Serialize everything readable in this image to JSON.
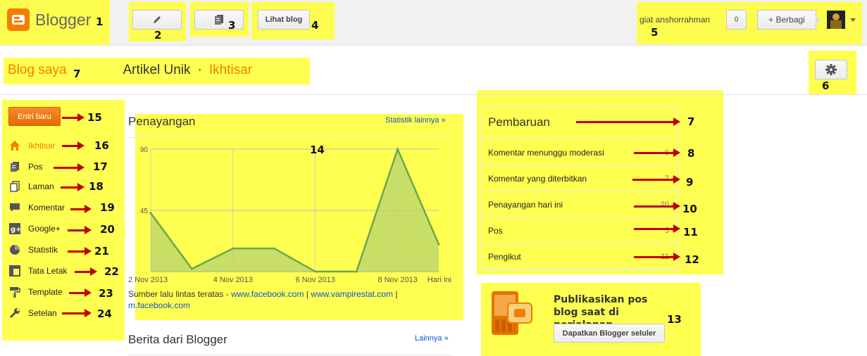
{
  "header": {
    "logo_text": "Blogger",
    "view_blog_label": "Lihat blog",
    "username": "giat anshorrahman",
    "notification_count": "0",
    "share_label": "+ Berbagi"
  },
  "breadcrumb": {
    "my_blogs": "Blog saya",
    "blog_name": "Artikel Unik",
    "separator": "·",
    "current": "Ikhtisar"
  },
  "sidebar": {
    "new_post_label": "Entri baru",
    "items": [
      {
        "label": "Ikhtisar",
        "icon": "home-icon",
        "active": true
      },
      {
        "label": "Pos",
        "icon": "posts-icon"
      },
      {
        "label": "Laman",
        "icon": "pages-icon"
      },
      {
        "label": "Komentar",
        "icon": "comment-icon"
      },
      {
        "label": "Google+",
        "icon": "google-plus-icon"
      },
      {
        "label": "Statistik",
        "icon": "pie-chart-icon"
      },
      {
        "label": "Tata Letak",
        "icon": "layout-icon"
      },
      {
        "label": "Template",
        "icon": "paint-roller-icon"
      },
      {
        "label": "Setelan",
        "icon": "wrench-icon"
      }
    ]
  },
  "pageviews": {
    "title": "Penayangan",
    "more_stats_link": "Statistik lainnya »",
    "traffic_prefix": "Sumber lalu lintas teratas -",
    "traffic_sources": [
      "www.facebook.com",
      "www.vampirestat.com",
      "m.facebook.com"
    ],
    "separator": "|"
  },
  "chart_data": {
    "type": "area",
    "x": [
      "2 Nov 2013",
      "3 Nov 2013",
      "4 Nov 2013",
      "5 Nov 2013",
      "6 Nov 2013",
      "7 Nov 2013",
      "8 Nov 2013",
      "9 Nov 2013",
      "Hari ini"
    ],
    "x_tick_labels": [
      "2 Nov 2013",
      "4 Nov 2013",
      "6 Nov 2013",
      "8 Nov 2013",
      "Hari ini"
    ],
    "y_tick_labels": [
      "90",
      "45"
    ],
    "values": [
      43,
      2,
      17,
      17,
      0,
      0,
      90,
      20
    ],
    "ylim": [
      0,
      90
    ],
    "color": "#6aa84f"
  },
  "news": {
    "title": "Berita dari Blogger",
    "more_link": "Lainnya »"
  },
  "updates": {
    "title": "Pembaruan",
    "rows": [
      {
        "label": "Komentar menunggu moderasi",
        "value": "0 »"
      },
      {
        "label": "Komentar yang diterbitkan",
        "value": "7 »"
      },
      {
        "label": "Penayangan hari ini",
        "value": "20 »"
      },
      {
        "label": "Pos",
        "value": "5 »"
      },
      {
        "label": "Pengikut",
        "value": "11 »"
      }
    ]
  },
  "mobile_promo": {
    "text": "Publikasikan pos blog saat di perjalanan",
    "button_label": "Dapatkan Blogger seluler"
  },
  "annotations": {
    "n1": "1",
    "n2": "2",
    "n3": "3",
    "n4": "4",
    "n5": "5",
    "n6": "6",
    "n7a": "7",
    "n7b": "7",
    "n8": "8",
    "n9": "9",
    "n10": "10",
    "n11": "11",
    "n12": "12",
    "n13": "13",
    "n14": "14",
    "n15": "15",
    "n16": "16",
    "n17": "17",
    "n18": "18",
    "n19": "19",
    "n20": "20",
    "n21": "21",
    "n22": "22",
    "n23": "23",
    "n24": "24"
  },
  "colors": {
    "highlight": "#ffff33",
    "brand_orange": "#f57d00",
    "arrow_red": "#c00000"
  }
}
